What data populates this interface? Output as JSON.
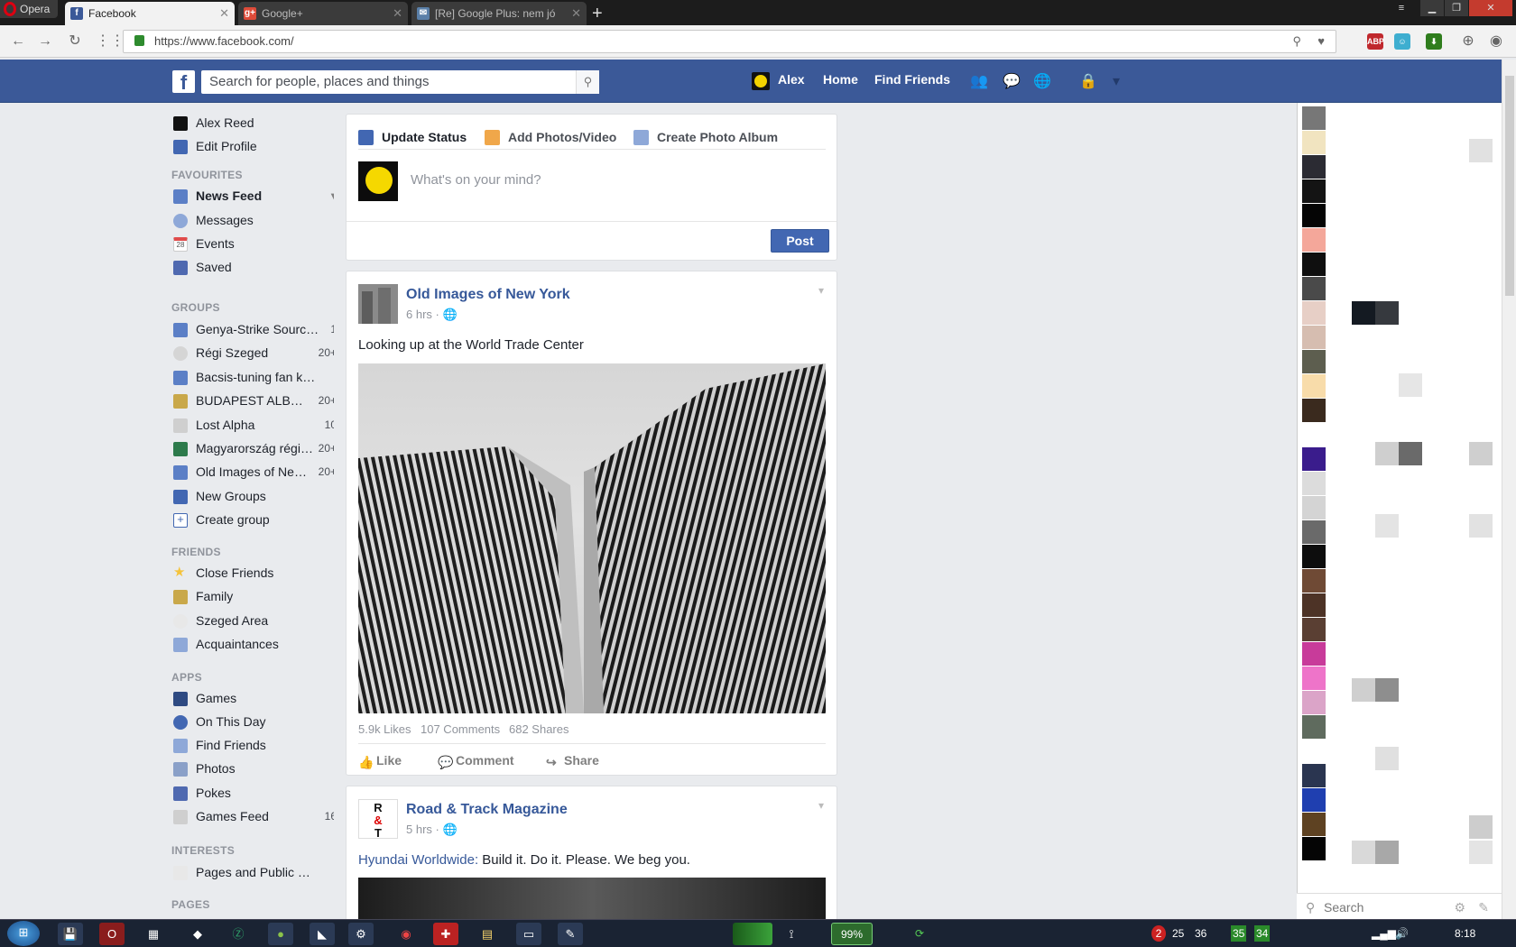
{
  "browser": {
    "brand": "Opera",
    "tabs": [
      {
        "title": "Facebook",
        "favicon": "facebook-icon",
        "active": true
      },
      {
        "title": "Google+",
        "favicon": "google-plus-icon",
        "active": false
      },
      {
        "title": "[Re] Google Plus: nem jó",
        "favicon": "mail-icon",
        "active": false
      }
    ],
    "url": "https://www.facebook.com/",
    "extensions": [
      "ABP",
      "2"
    ]
  },
  "fb_header": {
    "search_placeholder": "Search for people, places and things",
    "user_name": "Alex",
    "home": "Home",
    "find_friends": "Find Friends"
  },
  "left_nav": {
    "profile": "Alex Reed",
    "edit_profile": "Edit Profile",
    "favourites_heading": "FAVOURITES",
    "favourites": [
      {
        "label": "News Feed",
        "icon": "news-feed-icon"
      },
      {
        "label": "Messages",
        "icon": "messages-icon"
      },
      {
        "label": "Events",
        "icon": "events-icon",
        "badge": "28"
      },
      {
        "label": "Saved",
        "icon": "saved-icon"
      }
    ],
    "groups_heading": "GROUPS",
    "groups": [
      {
        "label": "Genya-Strike Sourc…",
        "count": "1"
      },
      {
        "label": "Régi Szeged",
        "count": "20+"
      },
      {
        "label": "Bacsis-tuning fan k…",
        "count": ""
      },
      {
        "label": "BUDAPEST ALB…",
        "count": "20+"
      },
      {
        "label": "Lost Alpha",
        "count": "10"
      },
      {
        "label": "Magyarország régi…",
        "count": "20+"
      },
      {
        "label": "Old Images of Ne…",
        "count": "20+"
      },
      {
        "label": "New Groups",
        "count": ""
      },
      {
        "label": "Create group",
        "count": ""
      }
    ],
    "friends_heading": "FRIENDS",
    "friends": [
      "Close Friends",
      "Family",
      "Szeged Area",
      "Acquaintances"
    ],
    "apps_heading": "APPS",
    "apps": [
      {
        "label": "Games",
        "count": ""
      },
      {
        "label": "On This Day",
        "count": ""
      },
      {
        "label": "Find Friends",
        "count": ""
      },
      {
        "label": "Photos",
        "count": ""
      },
      {
        "label": "Pokes",
        "count": ""
      },
      {
        "label": "Games Feed",
        "count": "16"
      }
    ],
    "interests_heading": "INTERESTS",
    "interests": [
      "Pages and Public …"
    ],
    "pages_heading": "PAGES"
  },
  "composer": {
    "update_status": "Update Status",
    "add_photos": "Add Photos/Video",
    "create_album": "Create Photo Album",
    "placeholder": "What's on your mind?",
    "post": "Post"
  },
  "posts": [
    {
      "author": "Old Images of New York",
      "time": "6 hrs",
      "text": "Looking up at the World Trade Center",
      "likes": "5.9k Likes",
      "comments": "107 Comments",
      "shares": "682 Shares",
      "like": "Like",
      "comment": "Comment",
      "share": "Share"
    },
    {
      "author": "Road & Track Magazine",
      "time": "5 hrs",
      "link_text": "Hyundai Worldwide:",
      "text": " Build it. Do it. Please. We beg you."
    }
  ],
  "chat": {
    "search": "Search"
  },
  "taskbar": {
    "battery": "99%",
    "tray_numbers": [
      "2",
      "25",
      "36",
      "35",
      "34"
    ],
    "clock": "8:18"
  },
  "colors": {
    "fb_blue": "#3b5998",
    "link": "#365899",
    "opera_red": "#dd0011"
  }
}
